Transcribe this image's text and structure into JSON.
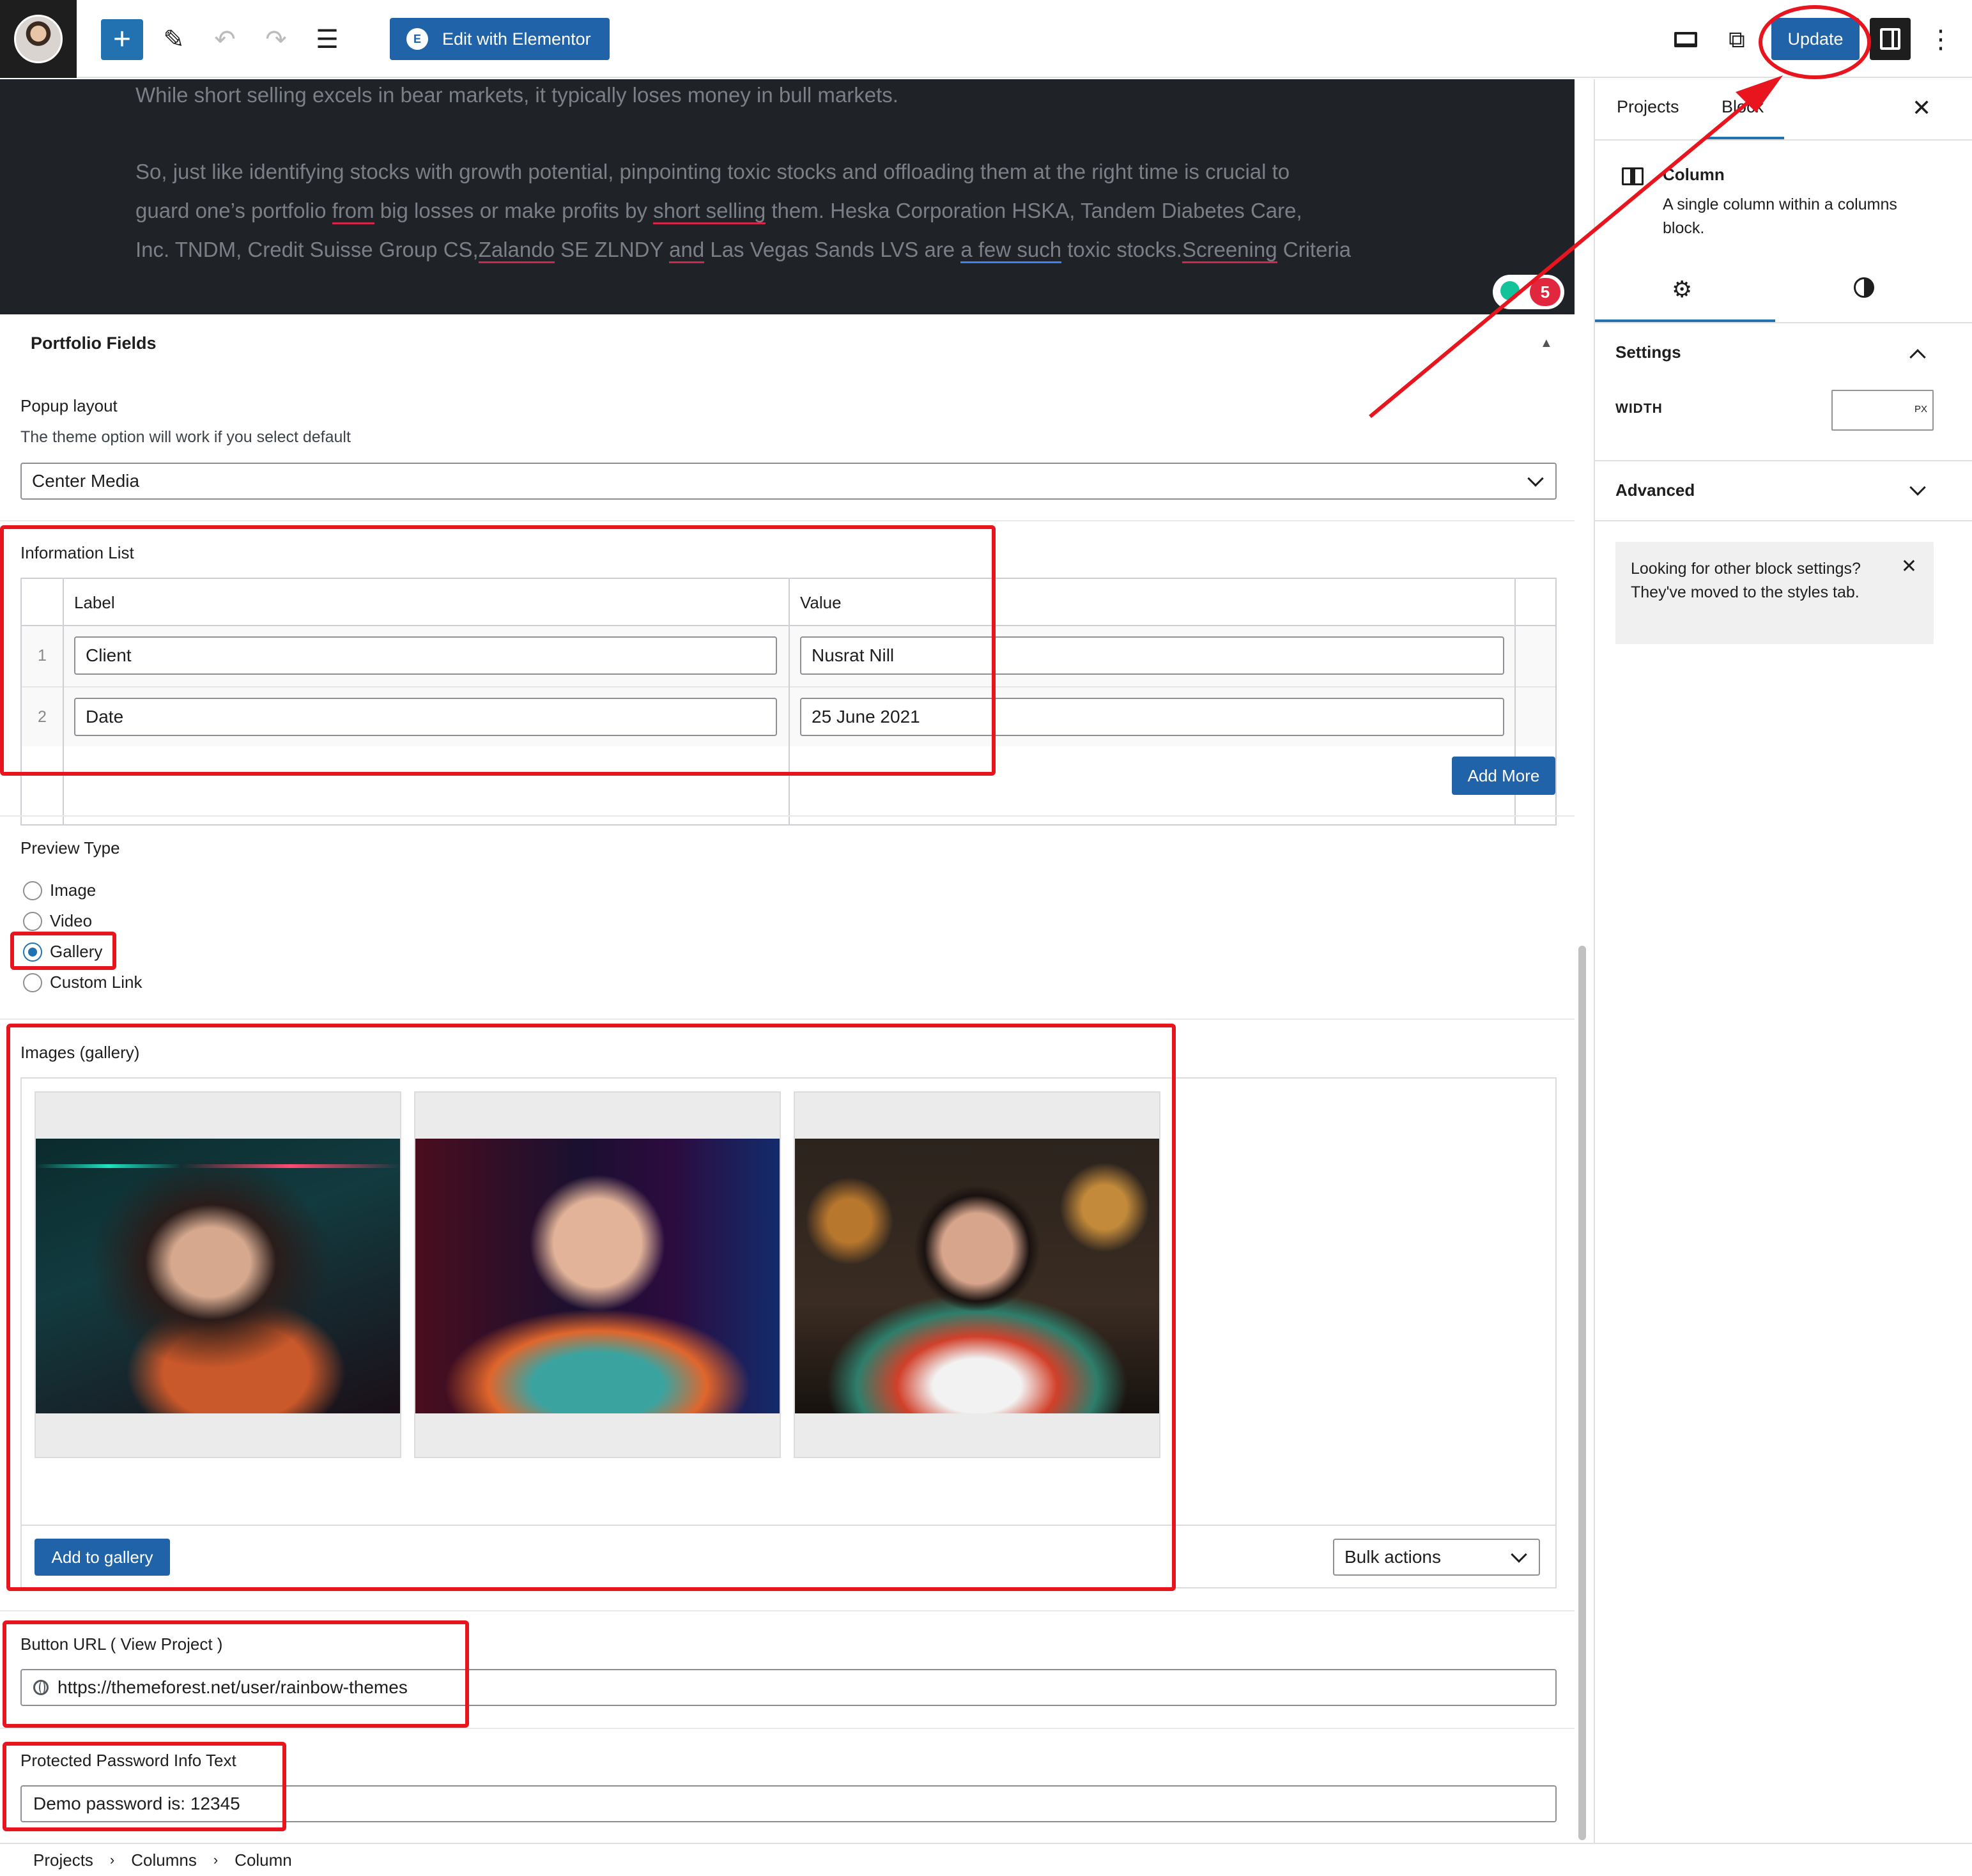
{
  "toolbar": {
    "edit_elementor_label": "Edit with Elementor",
    "elementor_badge": "E",
    "update_label": "Update",
    "icons": [
      "avatar",
      "plus-icon",
      "pencil-icon",
      "undo-icon",
      "redo-icon",
      "list-view-icon",
      "desktop-preview-icon",
      "external-link-icon",
      "sidebar-toggle-icon",
      "more-vertical-icon"
    ]
  },
  "article": {
    "line1": "While short selling excels in bear markets, it typically loses money in bull markets.",
    "para2_a": "So, just like identifying stocks with growth potential, pinpointing toxic stocks and offloading them at the right time is crucial to",
    "para2_b1": "guard one’s portfolio ",
    "para2_b2": "from",
    "para2_b3": " big losses or make profits by ",
    "para2_b4": "short selling",
    "para2_b5": " them. Heska Corporation HSKA, Tandem Diabetes Care,",
    "para2_c1": "Inc. TNDM, Credit Suisse Group CS,",
    "para2_c2": "Zalando",
    "para2_c3": " SE ZLNDY ",
    "para2_c4": "and",
    "para2_c5": " Las Vegas Sands LVS are ",
    "para2_c6": "a few such",
    "para2_c7": " toxic stocks.",
    "para2_c8": "Screening",
    "para2_c9": " Criteria",
    "grammar_count": "5"
  },
  "portfolio": {
    "title": "Portfolio Fields",
    "popup_label": "Popup layout",
    "popup_desc": "The theme option will work if you select default",
    "popup_value": "Center Media",
    "info_title": "Information List",
    "info_headers": [
      "Label",
      "Value"
    ],
    "info_rows": [
      {
        "num": "1",
        "label": "Client",
        "value": "Nusrat Nill"
      },
      {
        "num": "2",
        "label": "Date",
        "value": "25 June 2021"
      }
    ],
    "add_more": "Add More",
    "preview_title": "Preview Type",
    "preview_options": [
      "Image",
      "Video",
      "Gallery",
      "Custom Link"
    ],
    "preview_selected": "Gallery",
    "gallery_title": "Images (gallery)",
    "add_gallery": "Add to gallery",
    "bulk_actions": "Bulk actions",
    "button_url_label": "Button URL ( View Project )",
    "button_url_value": "https://themeforest.net/user/rainbow-themes",
    "password_label": "Protected Password Info Text",
    "password_value": "Demo password is: 12345"
  },
  "sidebar": {
    "tab_projects": "Projects",
    "tab_block": "Block",
    "block_title": "Column",
    "block_desc": "A single column within a columns block.",
    "settings_title": "Settings",
    "width_label": "WIDTH",
    "width_unit": "PX",
    "advanced_title": "Advanced",
    "notice": "Looking for other block settings? They've moved to the styles tab."
  },
  "breadcrumb": [
    "Projects",
    "Columns",
    "Column"
  ],
  "colors": {
    "accent": "#2163a8",
    "annotation": "#e8141e",
    "dark_block_bg": "#1f2226"
  }
}
